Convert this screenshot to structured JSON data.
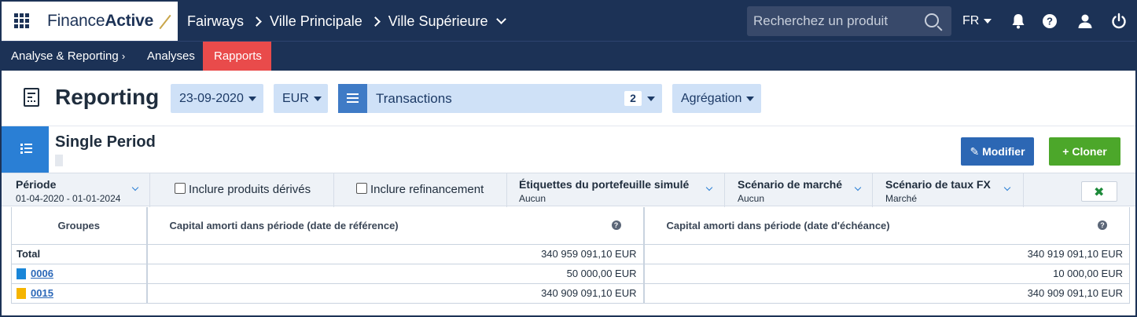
{
  "brand": {
    "name_part1": "Finance",
    "name_part2": "Active"
  },
  "breadcrumb": {
    "items": [
      "Fairways",
      "Ville Principale",
      "Ville Supérieure"
    ]
  },
  "search": {
    "placeholder": "Recherchez un produit"
  },
  "language": "FR",
  "icons": {
    "notifications": "bell-icon",
    "help": "question-icon",
    "user": "user-icon",
    "power": "power-icon",
    "apps": "grid-icon"
  },
  "subnav": {
    "section": "Analyse & Reporting",
    "analyses": "Analyses",
    "rapports": "Rapports"
  },
  "reporting": {
    "title": "Reporting",
    "date": "23-09-2020",
    "currency": "EUR",
    "transactions_label": "Transactions",
    "transactions_count": "2",
    "aggregation": "Agrégation"
  },
  "report": {
    "title": "Single Period",
    "modify_label": "Modifier",
    "clone_label": "Cloner"
  },
  "filters": {
    "periode_label": "Période",
    "periode_value": "01-04-2020 - 01-01-2024",
    "include_derivatives": "Inclure produits dérivés",
    "include_refinancing": "Inclure refinancement",
    "tags_label": "Étiquettes du portefeuille simulé",
    "tags_value": "Aucun",
    "market_label": "Scénario de marché",
    "market_value": "Aucun",
    "fx_label": "Scénario de taux FX",
    "fx_value": "Marché",
    "export_icon": "excel-icon"
  },
  "table": {
    "headers": [
      "Groupes",
      "Capital amorti dans période (date de référence)",
      "Capital amorti dans période (date d'échéance)"
    ],
    "rows": [
      {
        "group": "Total",
        "ref": "340 959 091,10 EUR",
        "ech": "340 919 091,10 EUR"
      },
      {
        "group": "0006",
        "ref": "50 000,00 EUR",
        "ech": "10 000,00 EUR",
        "color": "#1a86d8"
      },
      {
        "group": "0015",
        "ref": "340 909 091,10 EUR",
        "ech": "340 909 091,10 EUR",
        "color": "#f5b400"
      }
    ]
  },
  "colors": {
    "navy": "#1c3256",
    "accent_red": "#e94b4b",
    "pill": "#cfe1f7",
    "blue_btn": "#2c67b4",
    "green_btn": "#4ca72a"
  }
}
